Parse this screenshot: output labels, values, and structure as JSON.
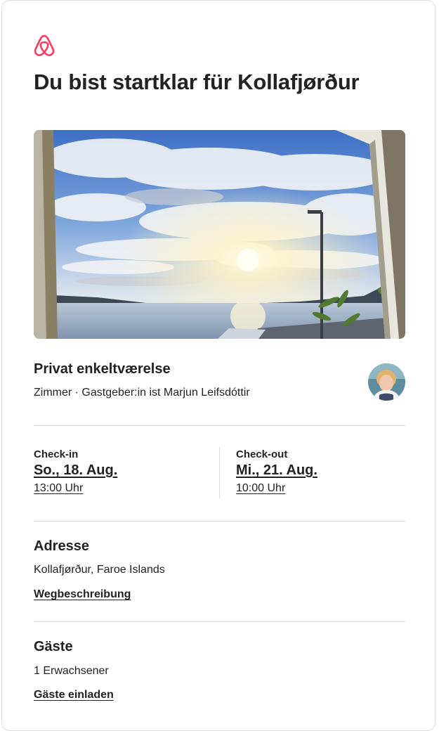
{
  "brand": {
    "logo_icon": "airbnb-belo-icon",
    "accent_color": "#FF385C"
  },
  "header": {
    "title": "Du bist startklar für Kollafjørður"
  },
  "listing": {
    "photo_description_icon": "listing-photo",
    "title": "Privat enkeltværelse",
    "subtitle": "Zimmer · Gastgeber:in ist Marjun Leifsdóttir",
    "host_avatar_icon": "host-avatar"
  },
  "checkin": {
    "label": "Check-in",
    "date": "So., 18. Aug.",
    "time": "13:00 Uhr"
  },
  "checkout": {
    "label": "Check-out",
    "date": "Mi., 21. Aug.",
    "time": "10:00 Uhr"
  },
  "address": {
    "heading": "Adresse",
    "value": "Kollafjørður, Faroe Islands",
    "link": "Wegbeschreibung"
  },
  "guests": {
    "heading": "Gäste",
    "value": "1 Erwachsener",
    "link": "Gäste einladen"
  }
}
